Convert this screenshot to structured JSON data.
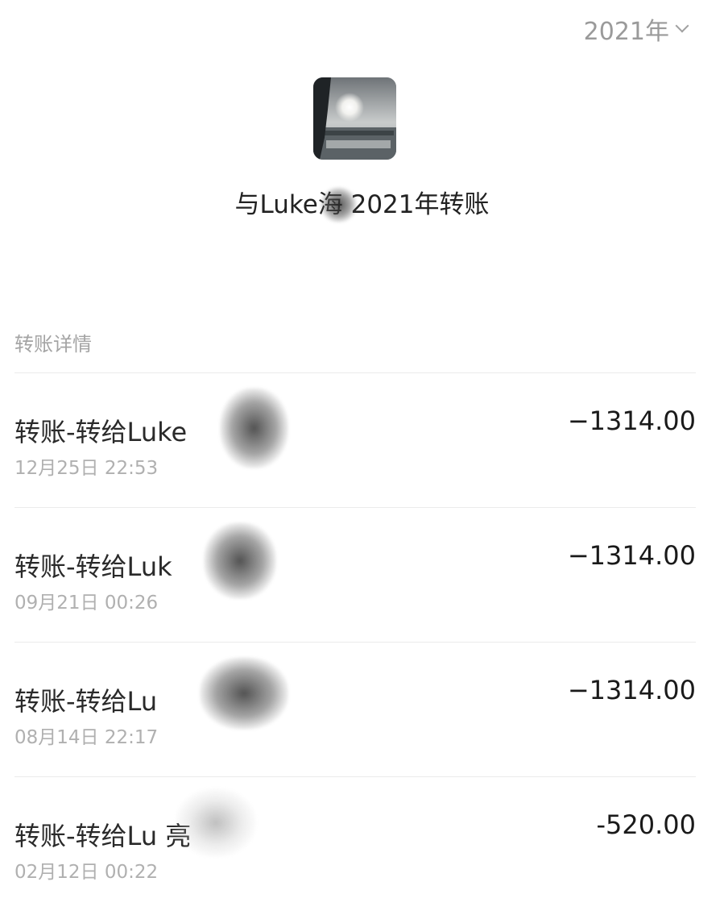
{
  "header": {
    "year": "2021年",
    "chevron_icon": "chevron-down-icon"
  },
  "profile": {
    "title": "与Luke海 2021年转账"
  },
  "section": {
    "label": "转账详情"
  },
  "transactions": [
    {
      "title": "转账-转给Luke",
      "date": "12月25日 22:53",
      "amount": "−1314.00"
    },
    {
      "title": "转账-转给Luk",
      "date": "09月21日 00:26",
      "amount": "−1314.00"
    },
    {
      "title": "转账-转给Lu",
      "date": "08月14日 22:17",
      "amount": "−1314.00"
    },
    {
      "title": "转账-转给Lu 亮",
      "date": "02月12日 00:22",
      "amount": "-520.00"
    }
  ]
}
